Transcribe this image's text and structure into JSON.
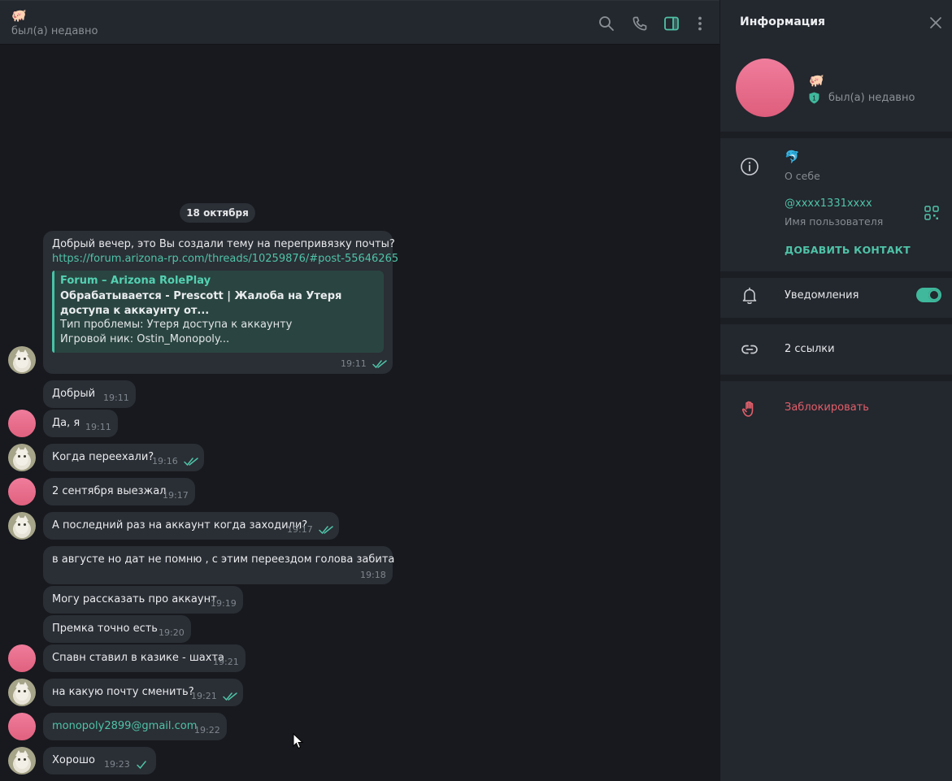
{
  "header": {
    "peer_emoji": "🐖",
    "status": "был(а) недавно",
    "icons": [
      "search-icon",
      "phone-icon",
      "sidebar-toggle-icon",
      "more-icon"
    ]
  },
  "date_label": "18 октября",
  "messages": {
    "m1": {
      "text": "Добрый вечер, это Вы создали тему на перепривязку почты?",
      "link": "https://forum.arizona-rp.com/threads/10259876/#post-55646265",
      "preview": {
        "site": "Forum – Arizona RolePlay",
        "title": "Обрабатывается - Prescott | Жалоба на Утеря доступа к аккаунту от...",
        "line1": "Тип проблемы: Утеря доступа к аккаунту",
        "line2": "Игровой ник: Ostin_Monopoly..."
      },
      "time": "19:11"
    },
    "m2": {
      "text": "Добрый",
      "time": "19:11"
    },
    "m3": {
      "text": "Да, я",
      "time": "19:11"
    },
    "m4": {
      "text": "Когда переехали?",
      "time": "19:16"
    },
    "m5": {
      "text": "2 сентября выезжал",
      "time": "19:17"
    },
    "m6": {
      "text": "А последний раз на аккаунт когда заходили?",
      "time": "19:17"
    },
    "m7": {
      "text": "в августе но дат не помню , с этим переездом голова забита",
      "time": "19:18"
    },
    "m8": {
      "text": "Могу рассказать про аккаунт",
      "time": "19:19"
    },
    "m9": {
      "text": "Премка точно есть",
      "time": "19:20"
    },
    "m10": {
      "text": "Спавн ставил в казике - шахта",
      "time": "19:21"
    },
    "m11": {
      "text": "на какую почту сменить?",
      "time": "19:21"
    },
    "m12": {
      "text": "monopoly2899@gmail.com",
      "time": "19:22"
    },
    "m13": {
      "text": "Хорошо",
      "time": "19:23"
    }
  },
  "panel": {
    "title": "Информация",
    "peer_emoji": "🐖",
    "badge": "1",
    "status": "был(а) недавно",
    "bio_emoji": "🐬",
    "bio_label": "О себе",
    "username": "@xxxx1331xxxx",
    "username_label": "Имя пользователя",
    "add_contact": "ДОБАВИТЬ КОНТАКТ",
    "notifications": "Уведомления",
    "links": "2 ссылки",
    "block": "Заблокировать"
  },
  "colors": {
    "accent": "#4fc3a7",
    "danger": "#e25f6a",
    "bubble": "#2a2e35",
    "background": "#17191e",
    "panel": "#23272e"
  }
}
